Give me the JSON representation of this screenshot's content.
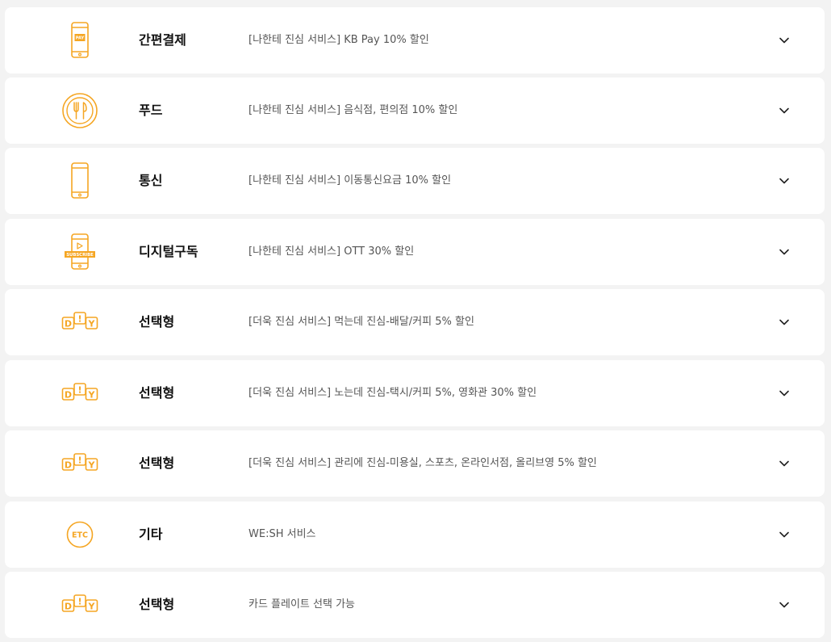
{
  "accent_color": "#f5a623",
  "rows": [
    {
      "icon": "pay-phone-icon",
      "category": "간편결제",
      "description": "[나한테 진심 서비스] KB Pay 10% 할인",
      "icon_text": "PAY"
    },
    {
      "icon": "food-fork-knife-icon",
      "category": "푸드",
      "description": "[나한테 진심 서비스] 음식점, 편의점 10% 할인"
    },
    {
      "icon": "mobile-phone-icon",
      "category": "통신",
      "description": "[나한테 진심 서비스] 이동통신요금 10% 할인"
    },
    {
      "icon": "subscribe-phone-icon",
      "category": "디지털구독",
      "description": "[나한테 진심 서비스] OTT 30% 할인",
      "icon_text": "SUBSCRIBE"
    },
    {
      "icon": "diy-icon",
      "category": "선택형",
      "description": "[더욱 진심 서비스] 먹는데 진심-배달/커피 5% 할인",
      "icon_text": "D!Y"
    },
    {
      "icon": "diy-icon",
      "category": "선택형",
      "description": "[더욱 진심 서비스] 노는데 진심-택시/커피 5%, 영화관 30% 할인",
      "icon_text": "D!Y"
    },
    {
      "icon": "diy-icon",
      "category": "선택형",
      "description": "[더욱 진심 서비스] 관리에 진심-미용실, 스포츠, 온라인서점, 올리브영 5% 할인",
      "icon_text": "D!Y"
    },
    {
      "icon": "etc-icon",
      "category": "기타",
      "description": "WE:SH 서비스",
      "icon_text": "ETC"
    },
    {
      "icon": "diy-icon",
      "category": "선택형",
      "description": "카드 플레이트 선택 가능",
      "icon_text": "D!Y"
    }
  ]
}
